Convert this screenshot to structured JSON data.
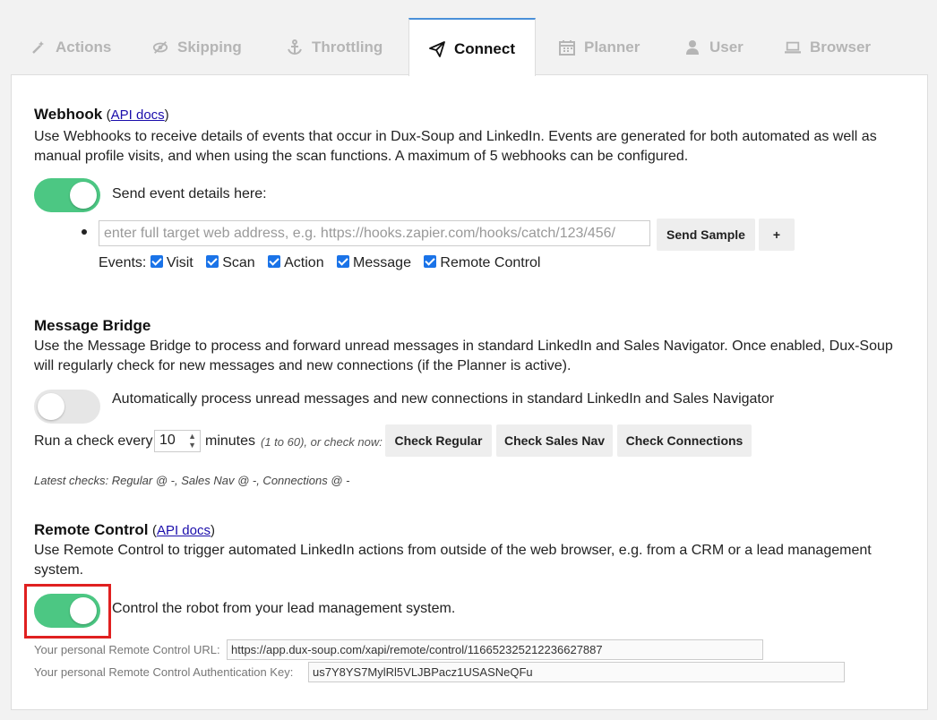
{
  "tabs": [
    {
      "label": "Actions",
      "icon": "wand-icon",
      "active": false
    },
    {
      "label": "Skipping",
      "icon": "eye-slash-icon",
      "active": false
    },
    {
      "label": "Throttling",
      "icon": "anchor-icon",
      "active": false
    },
    {
      "label": "Connect",
      "icon": "paper-plane-icon",
      "active": true
    },
    {
      "label": "Planner",
      "icon": "calendar-icon",
      "active": false
    },
    {
      "label": "User",
      "icon": "user-icon",
      "active": false
    },
    {
      "label": "Browser",
      "icon": "laptop-icon",
      "active": false
    }
  ],
  "webhook": {
    "title": "Webhook",
    "api_prefix": "(",
    "api_link": "API docs",
    "api_suffix": ")",
    "description": "Use Webhooks to receive details of events that occur in Dux-Soup and LinkedIn. Events are generated for both automated as well as manual profile visits, and when using the scan functions. A maximum of 5 webhooks can be configured.",
    "toggle_on": true,
    "toggle_label": "Send event details here:",
    "url_value": "",
    "url_placeholder": "enter full target web address, e.g. https://hooks.zapier.com/hooks/catch/123/456/",
    "send_sample": "Send Sample",
    "add": "+",
    "events_label": "Events:",
    "events": [
      {
        "label": "Visit",
        "checked": true
      },
      {
        "label": "Scan",
        "checked": true
      },
      {
        "label": "Action",
        "checked": true
      },
      {
        "label": "Message",
        "checked": true
      },
      {
        "label": "Remote Control",
        "checked": true
      }
    ]
  },
  "bridge": {
    "title": "Message Bridge",
    "description": "Use the Message Bridge to process and forward unread messages in standard LinkedIn and Sales Navigator. Once enabled, Dux-Soup will regularly check for new messages and new connections (if the Planner is active).",
    "toggle_on": false,
    "toggle_label": "Automatically process unread messages and new connections in standard LinkedIn and Sales Navigator",
    "run_prefix": "Run a check every",
    "interval": "10",
    "minutes": "minutes",
    "range_note": "(1 to 60), or check now:",
    "check_regular": "Check Regular",
    "check_sales_nav": "Check Sales Nav",
    "check_connections": "Check Connections",
    "latest": "Latest checks: Regular @ -, Sales Nav @ -, Connections @ -"
  },
  "remote": {
    "title": "Remote Control",
    "api_prefix": "(",
    "api_link": "API docs",
    "api_suffix": ")",
    "description": "Use Remote Control to trigger automated LinkedIn actions from outside of the web browser, e.g. from a CRM or a lead management system.",
    "toggle_on": true,
    "toggle_label": "Control the robot from your lead management system.",
    "url_label": "Your personal Remote Control URL:",
    "url_value": "https://app.dux-soup.com/xapi/remote/control/116652325212236627887",
    "key_label": "Your personal Remote Control Authentication Key:",
    "key_value": "us7Y8YS7MylRl5VLJBPacz1USASNeQFu"
  },
  "colors": {
    "toggle_on": "#4cc783",
    "toggle_off": "#e6e6e6",
    "highlight": "#e02020",
    "tab_accent": "#4a90d9"
  }
}
